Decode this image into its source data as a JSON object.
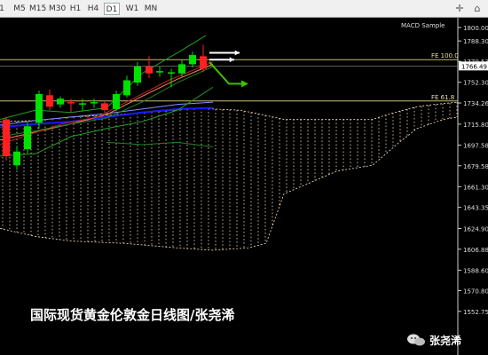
{
  "toolbar": {
    "timeframes": [
      {
        "label": "1",
        "active": false
      },
      {
        "label": "M5",
        "active": false
      },
      {
        "label": "M15",
        "active": false
      },
      {
        "label": "M30",
        "active": false
      },
      {
        "label": "H1",
        "active": false
      },
      {
        "label": "H4",
        "active": false
      },
      {
        "label": "D1",
        "active": true
      },
      {
        "label": "W1",
        "active": false
      },
      {
        "label": "MN",
        "active": false
      }
    ]
  },
  "chart": {
    "indicator_label": "MACD Sample",
    "price_labels": [
      "1800.00",
      "1788.30",
      "1770.53",
      "1752.30",
      "1734.26",
      "1715.80",
      "1697.58",
      "1679.58",
      "1661.30",
      "1643.35",
      "1624.90",
      "1606.88",
      "1588.60",
      "1570.80",
      "1552.75"
    ],
    "current_price": "1766.49",
    "fe_levels": [
      {
        "label": "FE 100.0",
        "price": 1772
      },
      {
        "label": "FE 61.8",
        "price": 1736
      }
    ],
    "colors": {
      "up": "#00e000",
      "down": "#ff2020",
      "fe_line": "#c8c070",
      "cloud": "#ffe0c0",
      "arrow_white": "#ffffff",
      "arrow_green": "#40c000"
    }
  },
  "watermark": "国际现货黄金伦敦金日线图/张尧浠",
  "brand": {
    "name": "张尧浠",
    "icon": "wechat-icon"
  }
}
